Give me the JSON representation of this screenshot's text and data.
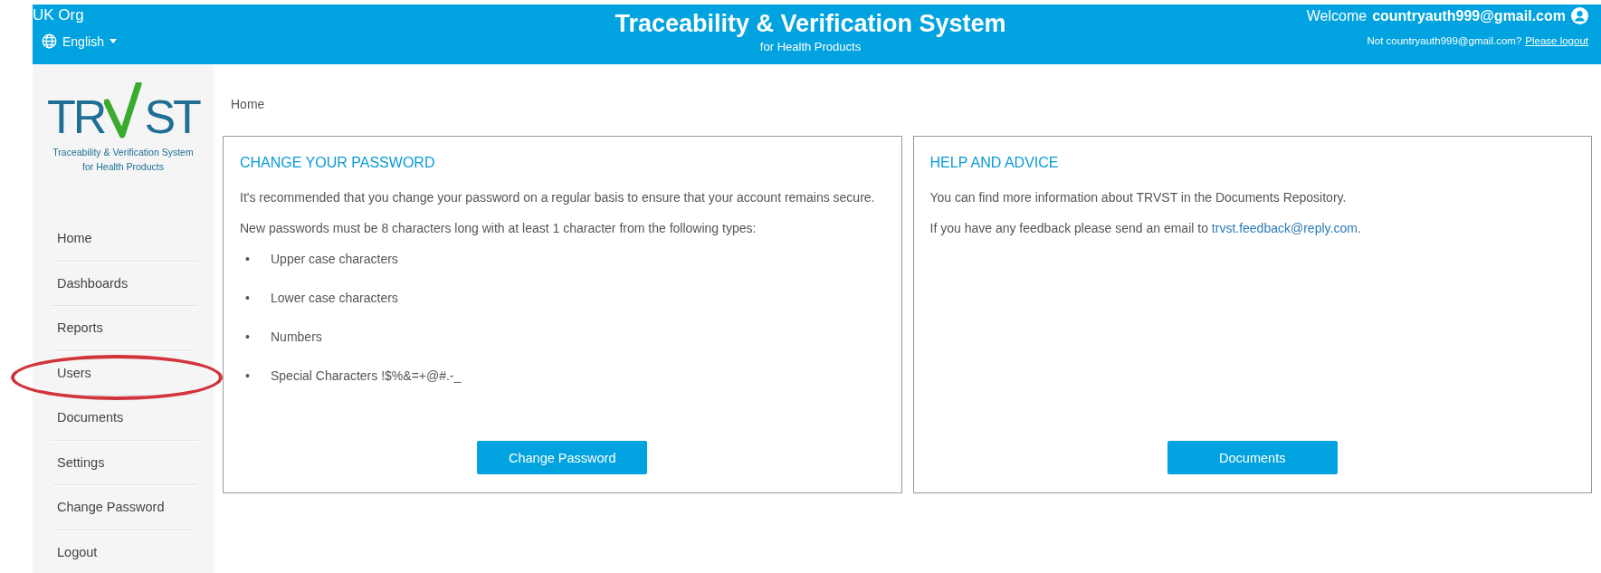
{
  "header": {
    "org": "UK Org",
    "language": "English",
    "title": "Traceability & Verification System",
    "subtitle": "for Health Products",
    "welcome": "Welcome",
    "user": "countryauth999@gmail.com",
    "not_user": "Not countryauth999@gmail.com?",
    "logout_link": "Please logout"
  },
  "sidebar": {
    "logo": {
      "wordmark_left": "TR",
      "wordmark_right": "ST",
      "caption_1": "Traceability & Verification System",
      "caption_2": "for Health Products"
    },
    "items": [
      {
        "label": "Home",
        "circled": false
      },
      {
        "label": "Dashboards",
        "circled": false
      },
      {
        "label": "Reports",
        "circled": false
      },
      {
        "label": "Users",
        "circled": true
      },
      {
        "label": "Documents",
        "circled": false
      },
      {
        "label": "Settings",
        "circled": false
      },
      {
        "label": "Change Password",
        "circled": false
      },
      {
        "label": "Logout",
        "circled": false
      }
    ]
  },
  "breadcrumb": "Home",
  "cards": [
    {
      "title": "CHANGE YOUR PASSWORD",
      "paragraphs": [
        {
          "text": "It's recommended that you change your password on a regular basis to ensure that your account remains secure."
        },
        {
          "text": "New passwords must be 8 characters long with at least 1 character from the following types:"
        }
      ],
      "bullets": [
        {
          "marker": "•",
          "text": "Upper case characters"
        },
        {
          "marker": "•",
          "text": "Lower case characters"
        },
        {
          "marker": "•",
          "text": "Numbers"
        },
        {
          "marker": "•",
          "text": "Special Characters !$%&=+@#.-_"
        }
      ],
      "button": "Change Password"
    },
    {
      "title": "HELP AND ADVICE",
      "paragraphs": [
        {
          "text": "You can find more information about TRVST in the Documents Repository."
        },
        {
          "text": "If you have any feedback please send an email to",
          "link": "trvst.feedback@reply.com",
          "after": "."
        }
      ],
      "button": "Documents"
    }
  ]
}
